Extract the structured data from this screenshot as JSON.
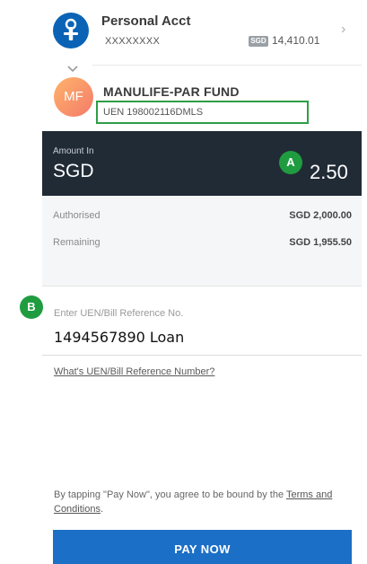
{
  "from_account": {
    "name": "Personal Acct",
    "number": "XXXXXXXX",
    "currency_badge": "SGD",
    "balance": "14,410.01",
    "logo_icon": "bank-logo-icon",
    "chevron_icon": "chevron-right-icon"
  },
  "payee": {
    "avatar_initials": "MF",
    "name": "MANULIFE-PAR FUND",
    "uen": "UEN 198002116DMLS",
    "highlight_color": "#2e9e45"
  },
  "amount": {
    "label": "Amount In",
    "currency": "SGD",
    "value": "2.50",
    "panel_color": "#212b36"
  },
  "markers": {
    "a": "A",
    "b": "B",
    "color": "#1f9c3f"
  },
  "limits": [
    {
      "label": "Authorised",
      "value": "SGD 2,000.00"
    },
    {
      "label": "Remaining",
      "value": "SGD 1,955.50"
    }
  ],
  "reference": {
    "label": "Enter UEN/Bill Reference No.",
    "value": "1494567890 Loan",
    "help_link": "What's UEN/Bill Reference Number?"
  },
  "footer": {
    "terms_text": "By tapping \"Pay Now\", you agree to be bound by the",
    "terms_link": "Terms and Conditions",
    "terms_end": ".",
    "pay_button": "PAY NOW",
    "button_color": "#1c6fc6"
  }
}
